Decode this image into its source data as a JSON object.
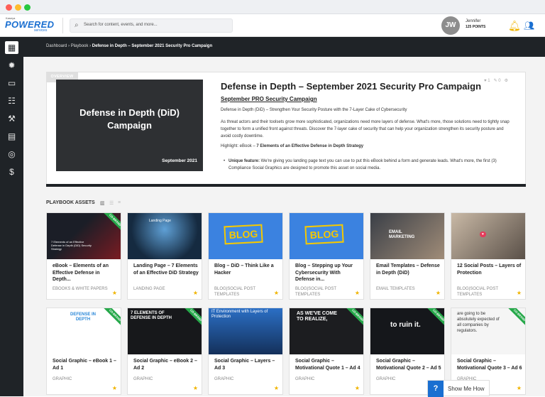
{
  "brand": {
    "small": "Kaseya",
    "main": "POWERED",
    "sub": "services"
  },
  "search": {
    "placeholder": "Search for content, events, and more..."
  },
  "user": {
    "initials": "JW",
    "name": "Jennifer",
    "points": "125 POINTS"
  },
  "breadcrumb": {
    "home": "Dashboard",
    "sep": "›",
    "section": "Playbook",
    "current": "Defense in Depth – September 2021 Security Pro Campaign"
  },
  "overview": {
    "tag": "OVERVIEW",
    "hero_title": "Defense in Depth (DiD) Campaign",
    "hero_date": "September 2021",
    "title": "Defense in Depth – September 2021 Security Pro Campaign",
    "likes": "1",
    "pins": "0",
    "subtitle": "September PRO Security Campaign",
    "p1": "Defense in Depth (DiD) – Strengthen Your Security Posture with the 7-Layer Cake of Cybersecurity",
    "p2": "As threat actors and their toolsets grow more sophisticated, organizations need more layers of defense. What's more, those solutions need to tightly snap together to form a unified front against threats. Discover the 7-layer cake of security that can help your organization strengthen its security posture and avoid costly downtime.",
    "p3_prefix": "Highlight: eBook – ",
    "p3_bold": "7 Elements of an Effective Defense in Depth Strategy",
    "bullet_bold": "Unique feature:",
    "bullet_text": " We're giving you landing page text you can use to put this eBook behind a form and generate leads. What's more, the first (3) Compliance Social Graphics are designed to promote this asset on social media."
  },
  "assets": {
    "heading": "PLAYBOOK ASSETS",
    "row1": [
      {
        "name": "eBook – Elements of an Effective Defense in Depth...",
        "category": "EBOOKS & WHITE PAPERS",
        "thumb": "7 Elements of an Effective Defense in Depth (DiD) Security Strategy",
        "ribbon": "CO-BRAND"
      },
      {
        "name": "Landing Page – 7 Elements of an Effective DiD Strategy",
        "category": "LANDING PAGE",
        "thumb": "Landing Page"
      },
      {
        "name": "Blog – DiD – Think Like a Hacker",
        "category": "BLOG|SOCIAL POST TEMPLATES",
        "thumb": "BLOG"
      },
      {
        "name": "Blog – Stepping up Your Cybersecurity With Defense in...",
        "category": "BLOG|SOCIAL POST TEMPLATES",
        "thumb": "BLOG"
      },
      {
        "name": "Email Templates – Defense in Depth (DiD)",
        "category": "EMAIL TEMPLATES",
        "thumb": "EMAIL MARKETING"
      },
      {
        "name": "12 Social Posts – Layers of Protection",
        "category": "BLOG|SOCIAL POST TEMPLATES",
        "thumb": "SOCIAL"
      }
    ],
    "row2": [
      {
        "name": "Social Graphic – eBook 1 – Ad 1",
        "category": "GRAPHIC",
        "thumb": "DEFENSE IN DEPTH",
        "ribbon": "CO-BRAND"
      },
      {
        "name": "Social Graphic – eBook 2 – Ad 2",
        "category": "GRAPHIC",
        "thumb": "7 ELEMENTS OF DEFENSE IN DEPTH",
        "ribbon": "CO-BRAND"
      },
      {
        "name": "Social Graphic – Layers – Ad 3",
        "category": "GRAPHIC",
        "thumb": "IT Environment with Layers of Protection"
      },
      {
        "name": "Social Graphic – Motivational Quote 1 – Ad 4",
        "category": "GRAPHIC",
        "thumb": "AS WE'VE COME TO REALIZE,",
        "ribbon": "CO-BRAND"
      },
      {
        "name": "Social Graphic – Motivational Quote 2 – Ad 5",
        "category": "GRAPHIC",
        "thumb": "to ruin it.",
        "ribbon": "CO-BRAND"
      },
      {
        "name": "Social Graphic – Motivational Quote 3 – Ad 6",
        "category": "GRAPHIC",
        "thumb": "are going to be absolutely expected of all companies by regulators.",
        "ribbon": "CO-BRAND"
      }
    ]
  },
  "help": {
    "q": "?",
    "label": "Show Me How"
  },
  "colors": {
    "accent": "#1a6fd1",
    "dark": "#1f2327",
    "star": "#f0b400",
    "ribbon": "#26a84a"
  }
}
